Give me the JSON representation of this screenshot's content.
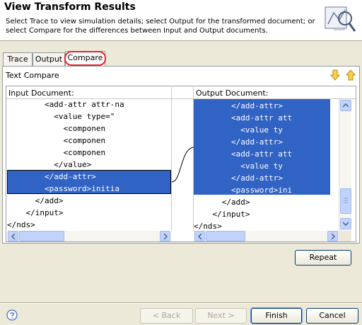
{
  "header": {
    "title": "View Transform Results",
    "description_line1": "Select Trace to view simulation details; select Output for the transformed document; or",
    "description_line2": "select Compare for the differences between Input and Output documents."
  },
  "tabs": [
    {
      "label": "Trace"
    },
    {
      "label": "Output"
    },
    {
      "label": "Compare",
      "selected": true
    }
  ],
  "compare": {
    "title": "Text Compare",
    "input_label": "Input Document:",
    "output_label": "Output Document:",
    "input_lines": [
      {
        "text": "        <add-attr attr-na",
        "selected": false
      },
      {
        "text": "          <value type=\"",
        "selected": false
      },
      {
        "text": "            <componen",
        "selected": false
      },
      {
        "text": "            <componen",
        "selected": false
      },
      {
        "text": "            <componen",
        "selected": false
      },
      {
        "text": "          </value>",
        "selected": false
      },
      {
        "text": "        </add-attr>",
        "selected": true
      },
      {
        "text": "        <password>initia",
        "selected": true
      },
      {
        "text": "      </add>",
        "selected": false
      },
      {
        "text": "    </input>",
        "selected": false
      },
      {
        "text": "</nds>",
        "selected": false
      }
    ],
    "output_lines": [
      {
        "text": "        </add-attr>",
        "selected": true
      },
      {
        "text": "        <add-attr att",
        "selected": true
      },
      {
        "text": "          <value ty",
        "selected": true
      },
      {
        "text": "        </add-attr>",
        "selected": true
      },
      {
        "text": "        <add-attr att",
        "selected": true
      },
      {
        "text": "          <value ty",
        "selected": true
      },
      {
        "text": "        </add-attr>",
        "selected": true
      },
      {
        "text": "        <password>ini",
        "selected": true
      },
      {
        "text": "      </add>",
        "selected": false
      },
      {
        "text": "    </input>",
        "selected": false
      },
      {
        "text": "</nds>",
        "selected": false
      }
    ]
  },
  "buttons": {
    "repeat": "Repeat",
    "back": "< Back",
    "next": "Next >",
    "finish": "Finish",
    "cancel": "Cancel"
  },
  "icons": {
    "help": "help-icon",
    "next_difference": "arrow-down-icon",
    "previous_difference": "arrow-up-icon",
    "wizard": "transform-wizard-icon"
  },
  "colors": {
    "selection": "#3163c5",
    "highlight_ring": "#e0262f",
    "arrow": "#f0b31c"
  }
}
